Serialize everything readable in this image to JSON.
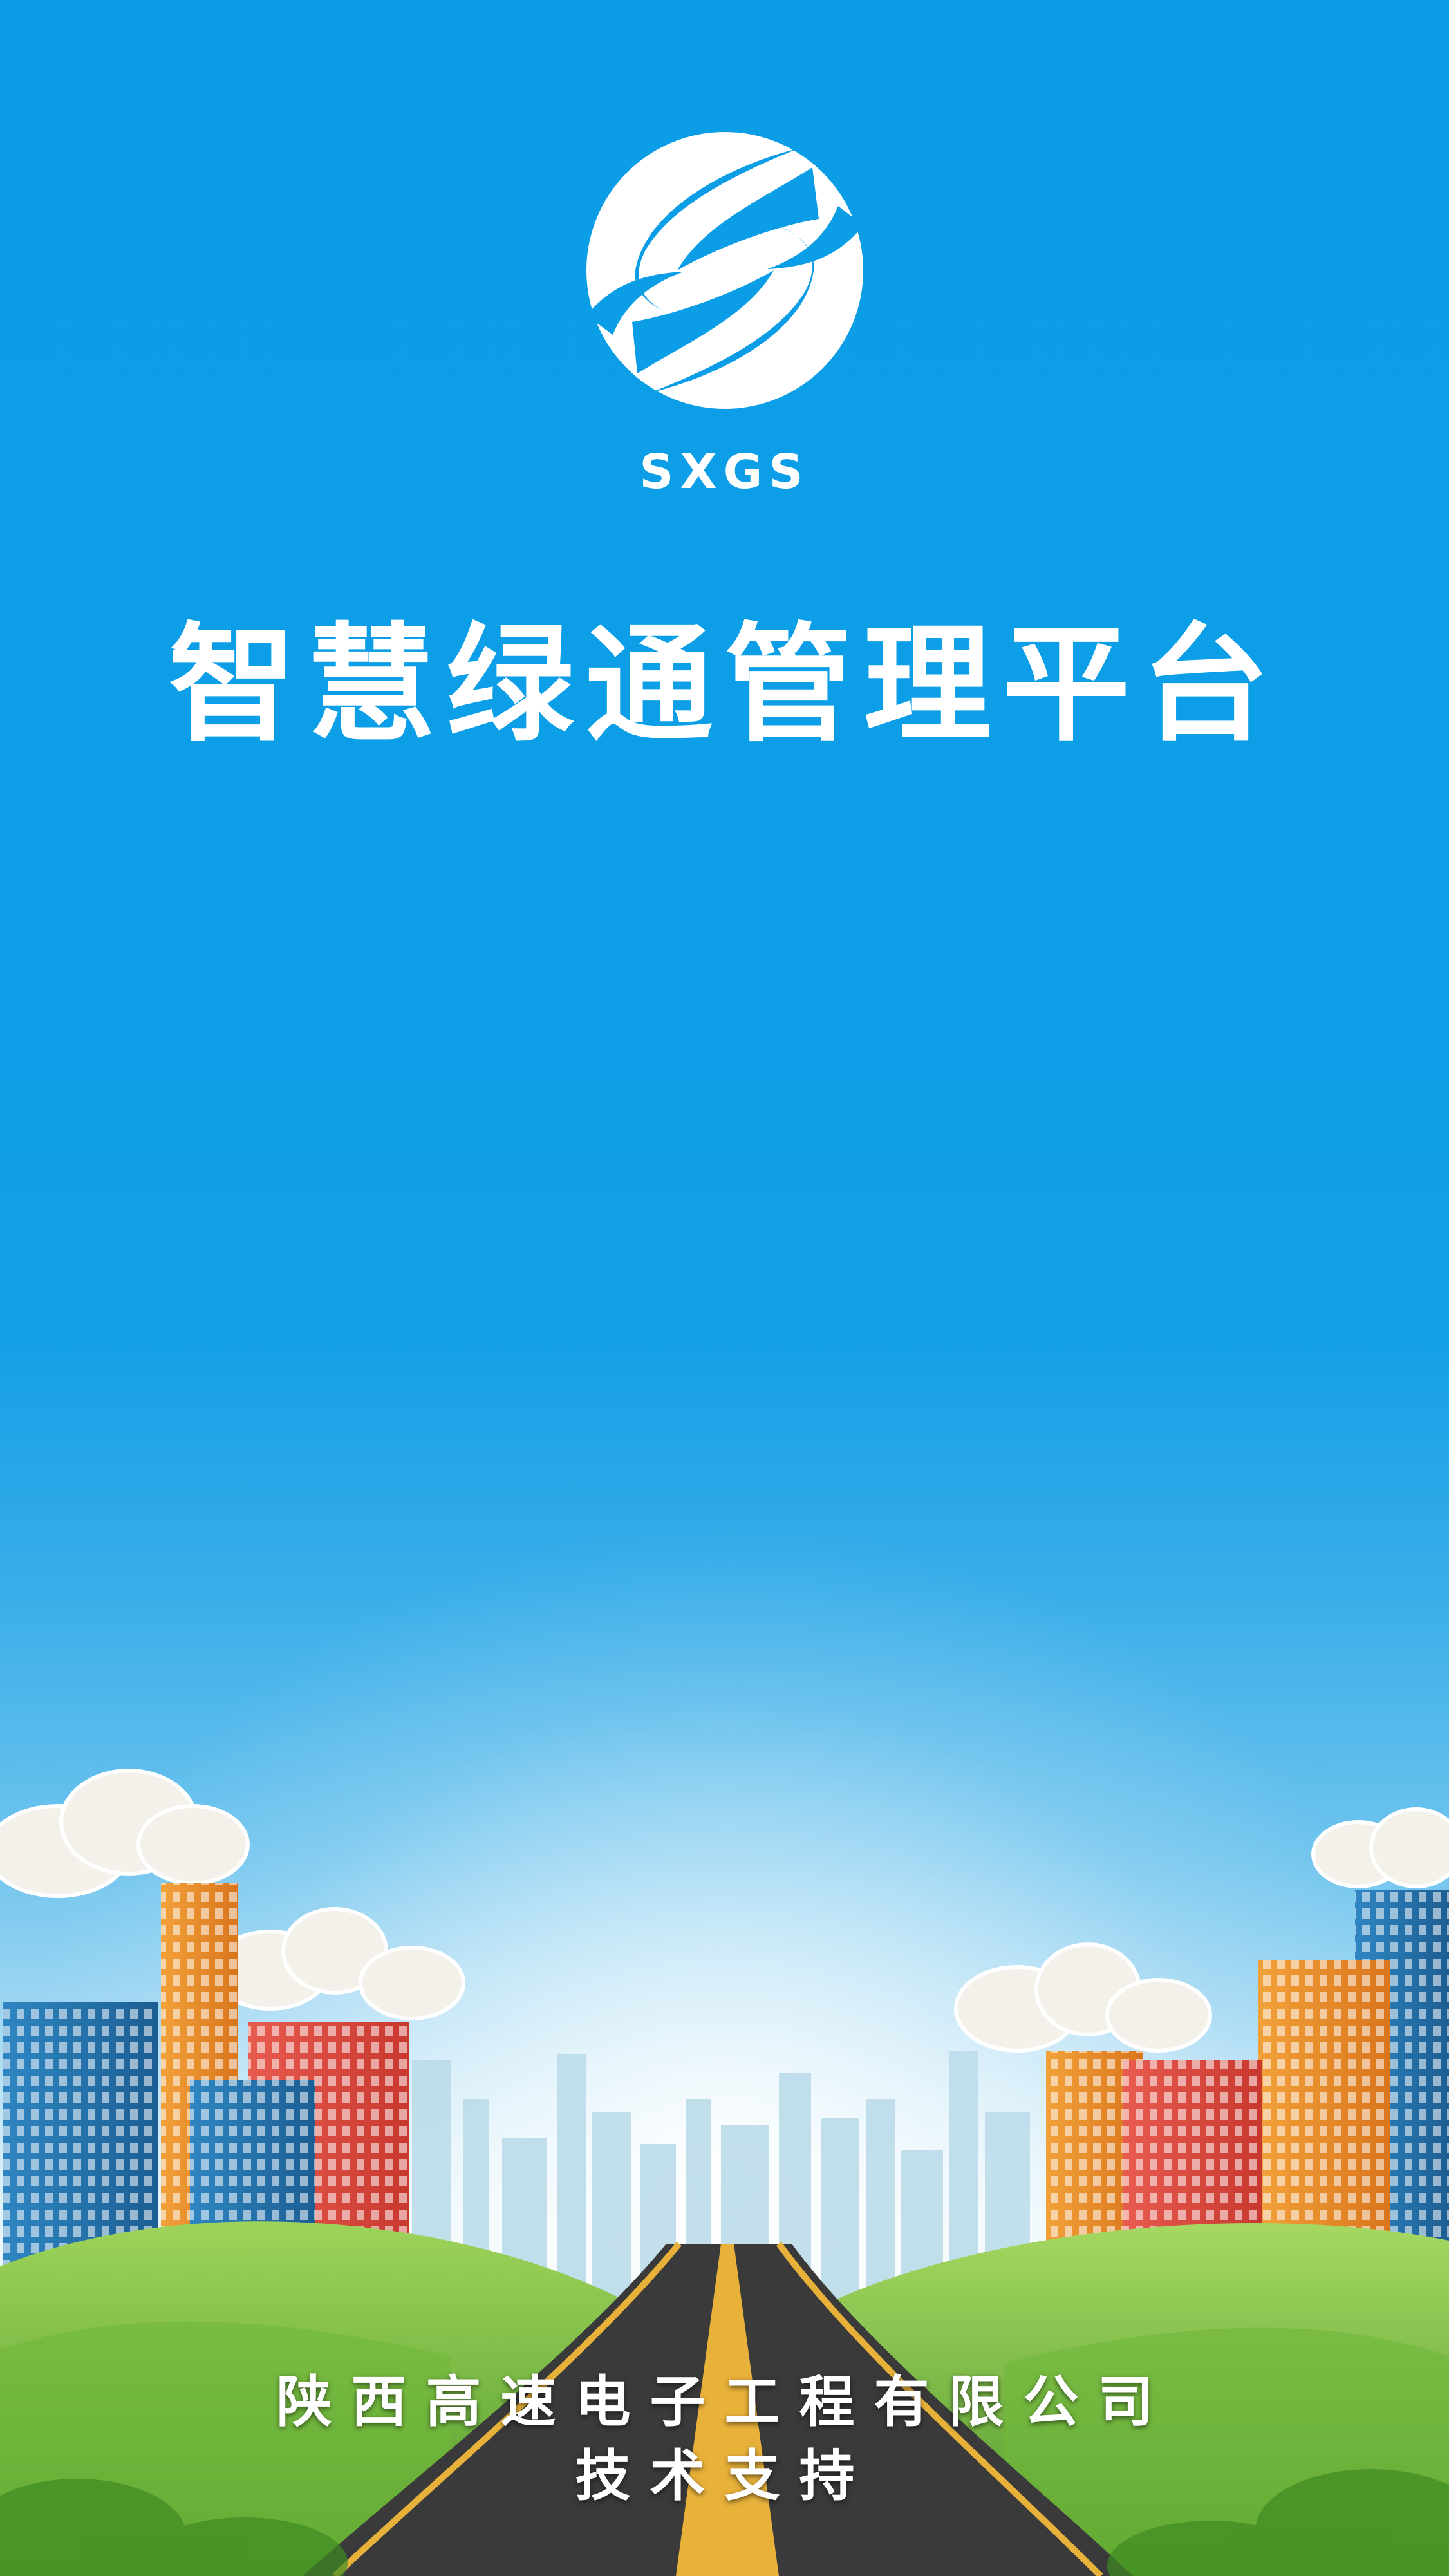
{
  "brand": {
    "logo_text": "SXGS",
    "app_title": "智慧绿通管理平台"
  },
  "footer": {
    "company": "陕西高速电子工程有限公司",
    "support": "技术支持"
  },
  "icons": {
    "logo": "sxgs-swirl-logo-icon"
  },
  "colors": {
    "sky_top": "#0b9de6",
    "sky_horizon": "#e9f6fb",
    "text": "#ffffff",
    "grass": "#7cc242",
    "road": "#3a3a3a",
    "road_line": "#e8b13a"
  }
}
